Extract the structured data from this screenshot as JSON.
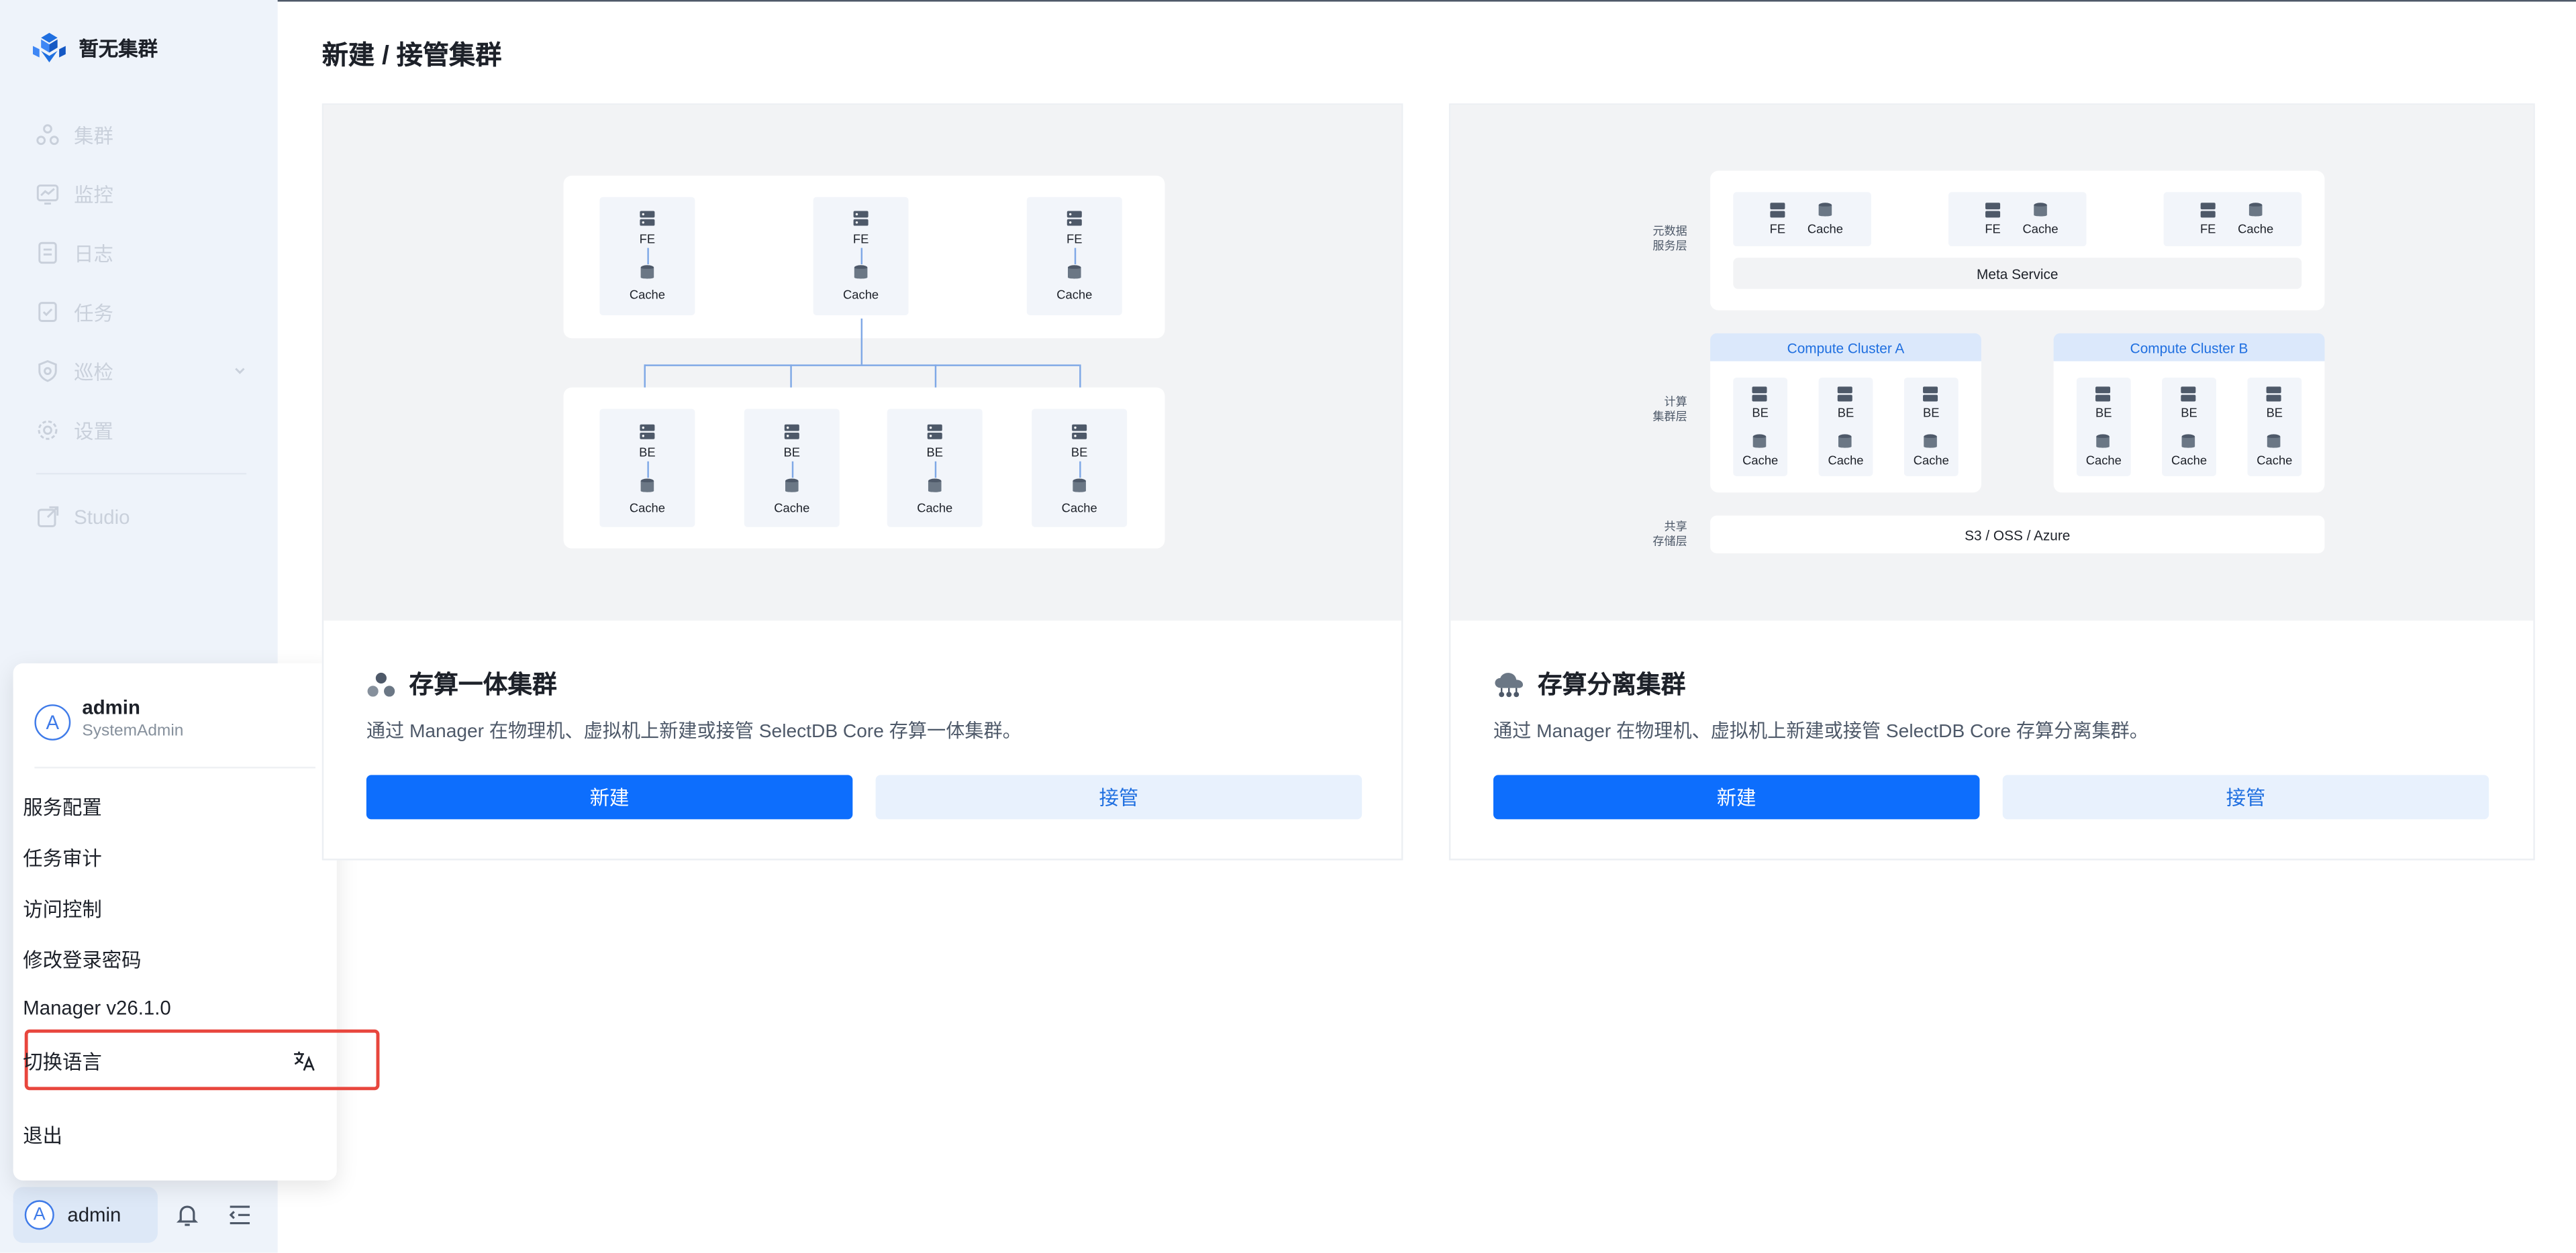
{
  "sidebar": {
    "brand": "暂无集群",
    "nav": [
      {
        "label": "集群",
        "icon": "cluster-icon"
      },
      {
        "label": "监控",
        "icon": "monitor-icon"
      },
      {
        "label": "日志",
        "icon": "log-icon"
      },
      {
        "label": "任务",
        "icon": "task-icon"
      },
      {
        "label": "巡检",
        "icon": "inspection-icon"
      },
      {
        "label": "设置",
        "icon": "settings-icon"
      }
    ],
    "studio": "Studio",
    "bottom": {
      "avatar_letter": "A",
      "username": "admin"
    }
  },
  "user_menu": {
    "avatar_letter": "A",
    "name": "admin",
    "role": "SystemAdmin",
    "items": [
      "服务配置",
      "任务审计",
      "访问控制",
      "修改登录密码",
      "Manager v26.1.0",
      "切换语言",
      "退出"
    ]
  },
  "main": {
    "title": "新建 / 接管集群",
    "cards": [
      {
        "title": "存算一体集群",
        "desc": "通过 Manager 在物理机、虚拟机上新建或接管 SelectDB Core 存算一体集群。",
        "primary": "新建",
        "secondary": "接管",
        "diagram": {
          "fe_nodes": [
            {
              "top": "FE",
              "bottom": "Cache"
            },
            {
              "top": "FE",
              "bottom": "Cache"
            },
            {
              "top": "FE",
              "bottom": "Cache"
            }
          ],
          "be_nodes": [
            {
              "top": "BE",
              "bottom": "Cache"
            },
            {
              "top": "BE",
              "bottom": "Cache"
            },
            {
              "top": "BE",
              "bottom": "Cache"
            },
            {
              "top": "BE",
              "bottom": "Cache"
            }
          ]
        }
      },
      {
        "title": "存算分离集群",
        "desc": "通过 Manager 在物理机、虚拟机上新建或接管 SelectDB Core 存算分离集群。",
        "primary": "新建",
        "secondary": "接管",
        "diagram": {
          "meta_layer_label": "元数据\n服务层",
          "compute_layer_label": "计算\n集群层",
          "storage_layer_label": "共享\n存储层",
          "fe_pairs": [
            {
              "a": "FE",
              "b": "Cache"
            },
            {
              "a": "FE",
              "b": "Cache"
            },
            {
              "a": "FE",
              "b": "Cache"
            }
          ],
          "meta_service": "Meta Service",
          "cluster_a": "Compute Cluster A",
          "cluster_b": "Compute Cluster B",
          "be_label": "BE",
          "cache_label": "Cache",
          "storage": "S3 / OSS / Azure"
        }
      }
    ]
  }
}
